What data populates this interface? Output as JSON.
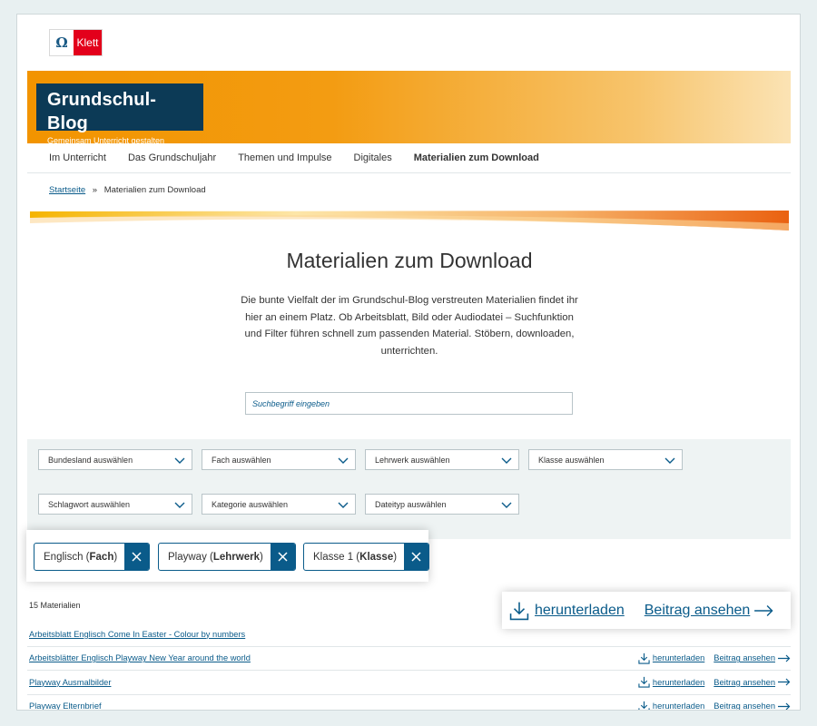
{
  "logo": {
    "mark": "Ω",
    "text": "Klett"
  },
  "brand": {
    "title": "Grundschul-Blog",
    "subtitle": "Gemeinsam Unterricht gestalten"
  },
  "nav": [
    {
      "label": "Im Unterricht"
    },
    {
      "label": "Das Grundschuljahr"
    },
    {
      "label": "Themen und Impulse"
    },
    {
      "label": "Digitales"
    },
    {
      "label": "Materialien zum Download",
      "active": true
    }
  ],
  "breadcrumb": {
    "home": "Startseite",
    "separator": "»",
    "current": "Materialien zum Download"
  },
  "page": {
    "title": "Materialien zum Download",
    "intro": "Die bunte Vielfalt der im Grundschul-Blog verstreuten Materialien findet ihr hier an einem Platz. Ob Arbeitsblatt, Bild oder Audiodatei – Suchfunktion und Filter führen schnell zum passenden Material. Stöbern, downloaden, unterrichten."
  },
  "search": {
    "placeholder": "Suchbegriff eingeben"
  },
  "filters": [
    "Bundesland auswählen",
    "Fach auswählen",
    "Lehrwerk auswählen",
    "Klasse auswählen",
    "Schlagwort auswählen",
    "Kategorie auswählen",
    "Dateityp auswählen"
  ],
  "chips": [
    {
      "value": "Englisch",
      "type": "Fach"
    },
    {
      "value": "Playway",
      "type": "Lehrwerk"
    },
    {
      "value": "Klasse 1",
      "type": "Klasse"
    }
  ],
  "results": {
    "count_label": "15 Materialien",
    "download_label": "herunterladen",
    "view_label": "Beitrag ansehen",
    "items": [
      "Arbeitsblatt Englisch Come In Easter - Colour by numbers",
      "Arbeitsblätter Englisch Playway New Year around the world",
      "Playway Ausmalbilder",
      "Playway Elternbrief"
    ]
  },
  "colors": {
    "accent": "#0a5b8a",
    "brand_dark": "#0c3a56",
    "banner_orange": "#f29400",
    "klett_red": "#e3001b"
  },
  "icons": {
    "download": "download-icon",
    "arrow": "arrow-right-icon",
    "remove": "close-icon",
    "dropdown": "chevron-down-icon"
  }
}
